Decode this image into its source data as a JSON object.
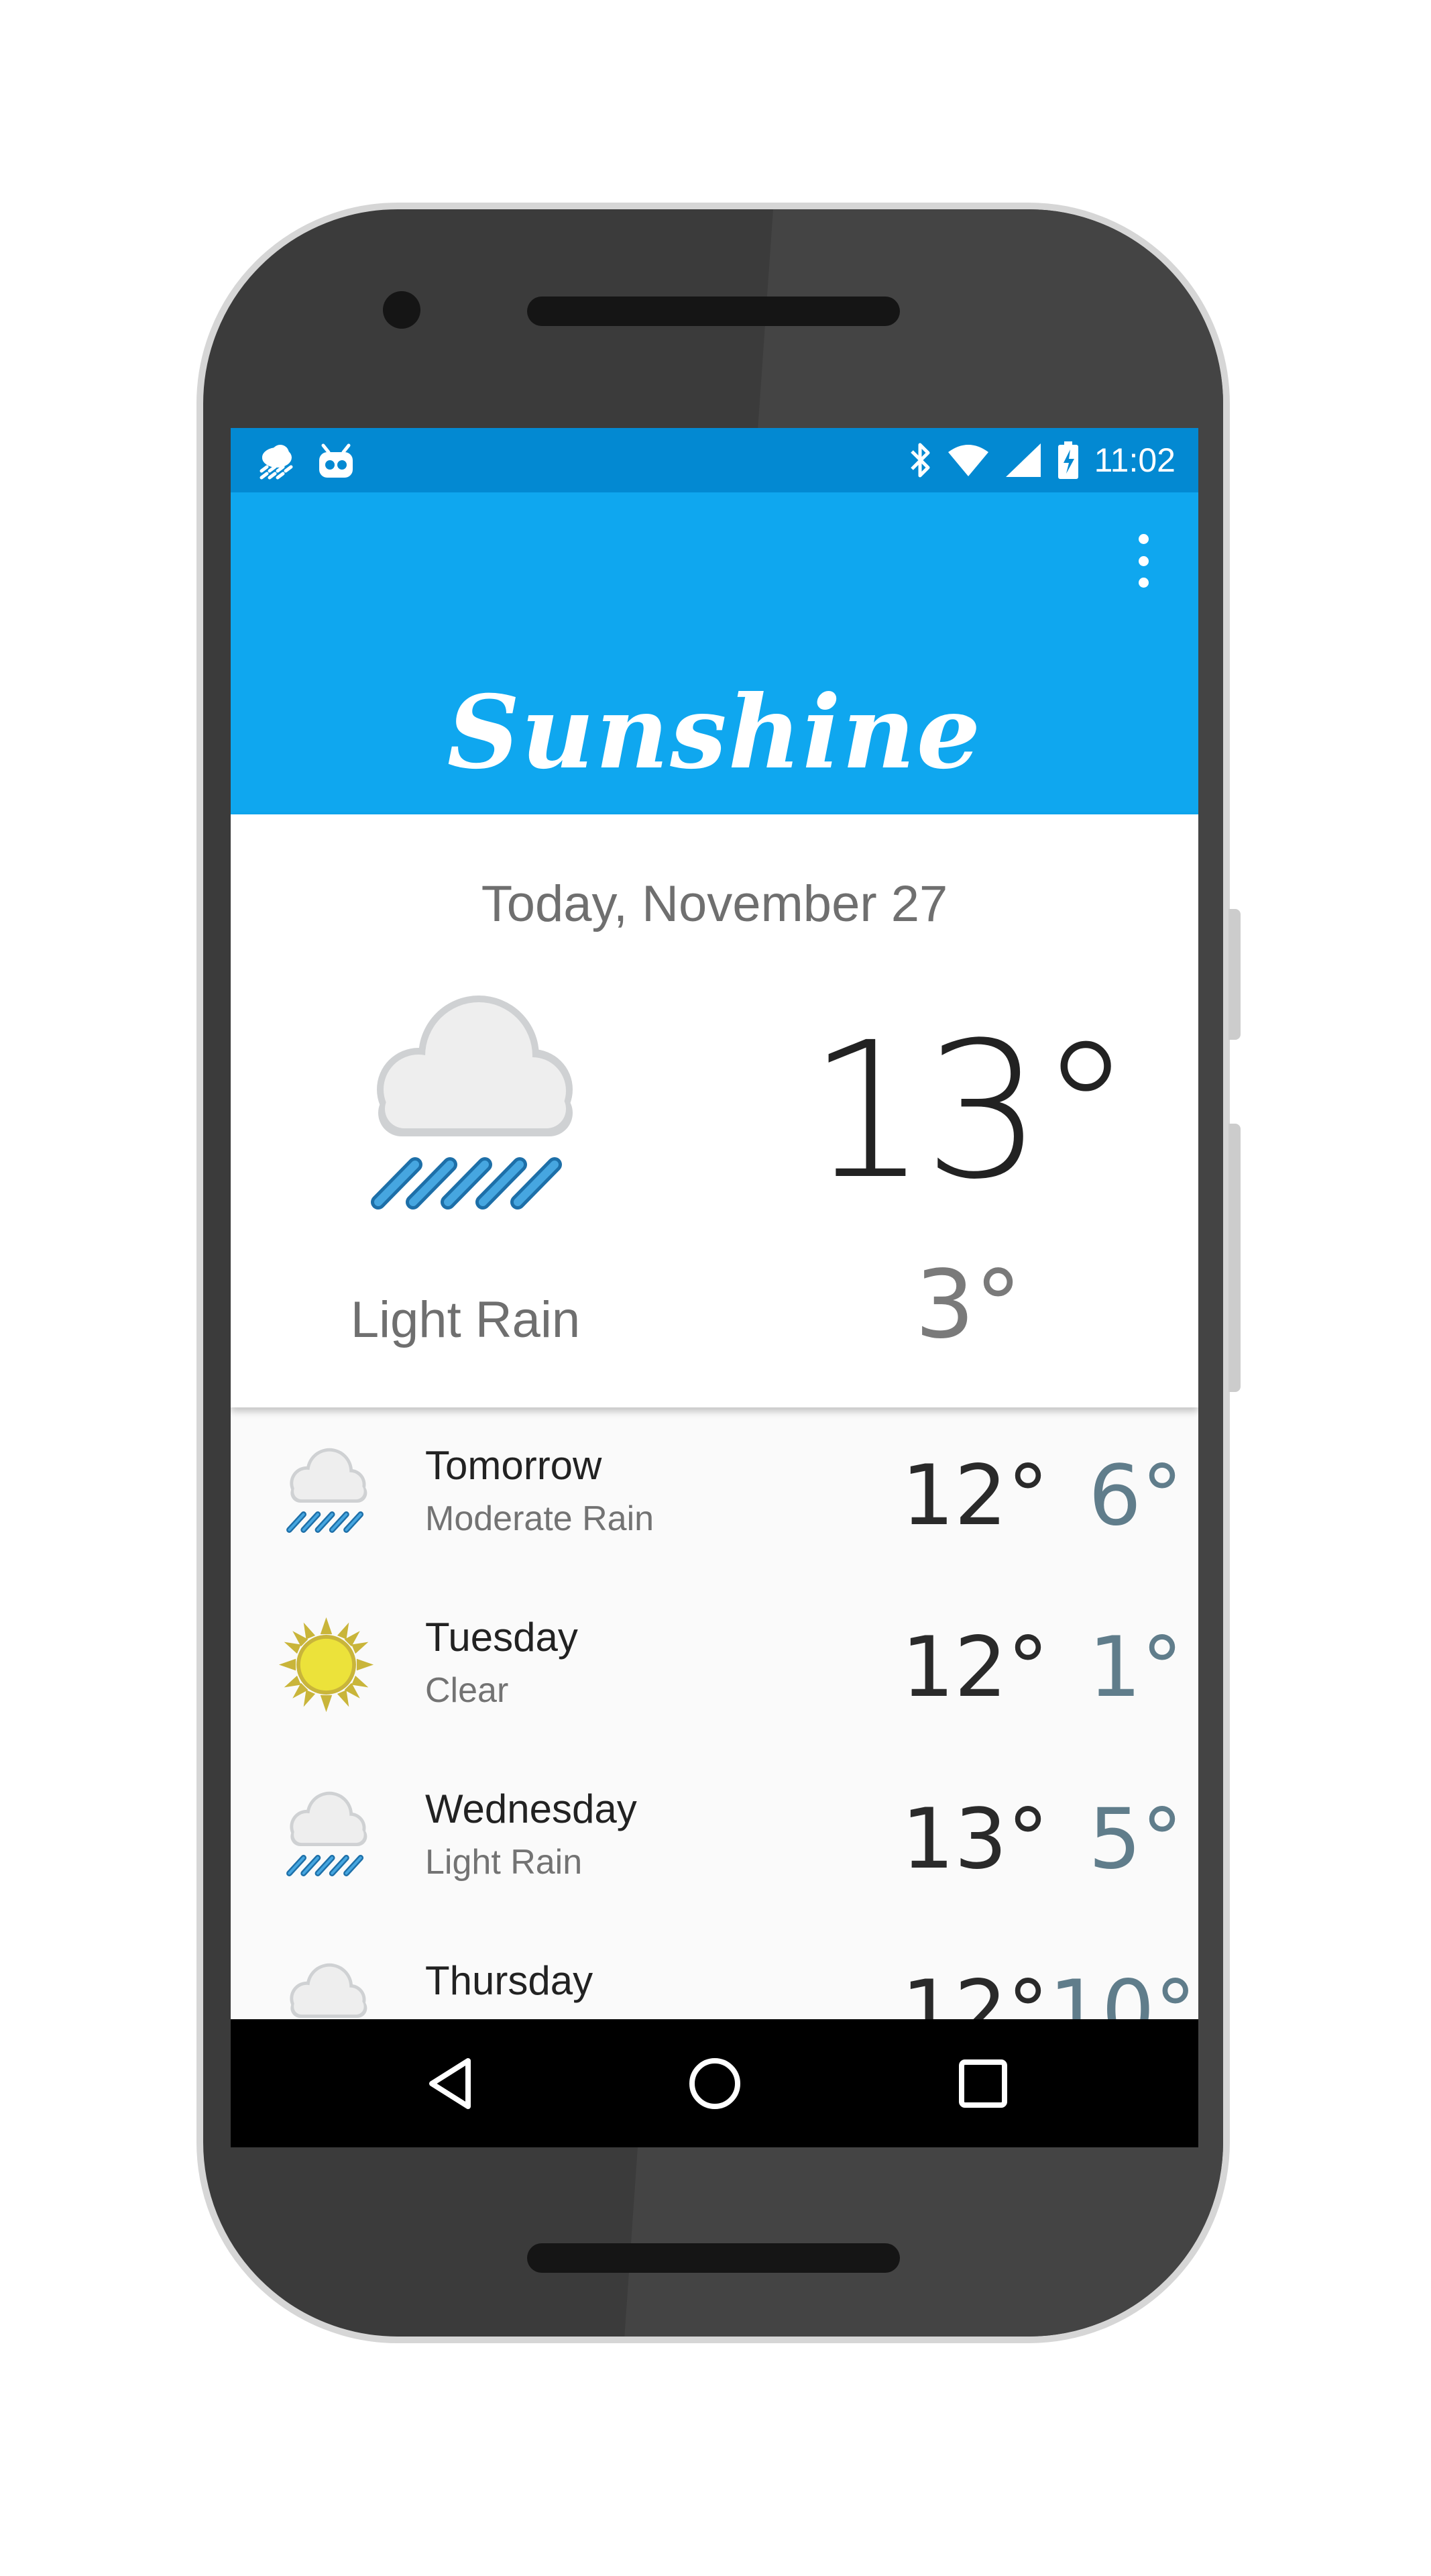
{
  "status_bar": {
    "time": "11:02",
    "left_icons": [
      "weather-notification-icon",
      "android-debug-icon"
    ],
    "right_icons": [
      "bluetooth-icon",
      "wifi-icon",
      "cell-signal-icon",
      "battery-charging-icon"
    ]
  },
  "app_bar": {
    "title": "Sunshine",
    "menu_icon": "overflow-menu-icon",
    "color": "#0fa7ef",
    "status_color": "#0389d2"
  },
  "today": {
    "date": "Today, November 27",
    "high": "13°",
    "low": "3°",
    "description": "Light Rain",
    "icon": "light-rain-icon"
  },
  "forecast": [
    {
      "day": "Tomorrow",
      "description": "Moderate Rain",
      "high": "12°",
      "low": "6°",
      "icon": "rain-icon"
    },
    {
      "day": "Tuesday",
      "description": "Clear",
      "high": "12°",
      "low": "1°",
      "icon": "sun-icon"
    },
    {
      "day": "Wednesday",
      "description": "Light Rain",
      "high": "13°",
      "low": "5°",
      "icon": "rain-icon"
    },
    {
      "day": "Thursday",
      "description": "",
      "high": "12°",
      "low": "10°",
      "icon": "cloud-icon"
    }
  ],
  "nav_bar": {
    "buttons": [
      "back-icon",
      "home-icon",
      "recents-icon"
    ]
  }
}
